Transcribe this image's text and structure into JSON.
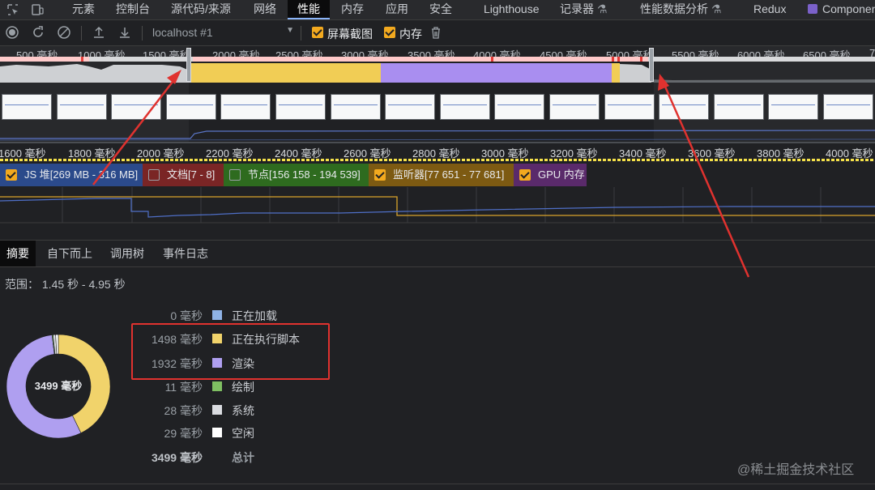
{
  "tabs": {
    "inspect_icon": "element-picker-icon",
    "device_icon": "device-toolbar-icon",
    "items": [
      {
        "label": "元素"
      },
      {
        "label": "控制台"
      },
      {
        "label": "源代码/来源"
      },
      {
        "label": "网络"
      },
      {
        "label": "性能"
      },
      {
        "label": "内存"
      },
      {
        "label": "应用"
      },
      {
        "label": "安全"
      },
      {
        "label": "Lighthouse"
      },
      {
        "label": "记录器"
      },
      {
        "label": "性能数据分析"
      },
      {
        "label": "Redux"
      },
      {
        "label": "Componen"
      }
    ],
    "active": "性能"
  },
  "toolbar": {
    "record_icon": "record-icon",
    "reload_icon": "reload-icon",
    "clear_icon": "clear-icon",
    "upload_icon": "upload-icon",
    "download_icon": "download-icon",
    "target": "localhost #1",
    "screenshots_label": "屏幕截图",
    "screenshots_checked": true,
    "memory_label": "内存",
    "memory_checked": true,
    "trash_icon": "trash-icon"
  },
  "overview": {
    "ticks": [
      "500 毫秒",
      "1000 毫秒",
      "1500 毫秒",
      "2000 毫秒",
      "2500 毫秒",
      "3000 毫秒",
      "3500 毫秒",
      "4000 毫秒",
      "4500 毫秒",
      "5000 毫秒",
      "5500 毫秒",
      "6000 毫秒",
      "6500 毫秒",
      "7"
    ],
    "selection_start_ms": 1450,
    "selection_end_ms": 4950
  },
  "timeline": {
    "ticks": [
      "1600 毫秒",
      "1800 毫秒",
      "2000 毫秒",
      "2200 毫秒",
      "2400 毫秒",
      "2600 毫秒",
      "2800 毫秒",
      "3000 毫秒",
      "3200 毫秒",
      "3400 毫秒",
      "3600 毫秒",
      "3800 毫秒",
      "4000 毫秒"
    ]
  },
  "counters": [
    {
      "label": "JS 堆[269 MB - 316 MB]",
      "checked": true,
      "color": "#2b4a8b"
    },
    {
      "label": "文档[7 - 8]",
      "checked": false,
      "color": "#7a2525"
    },
    {
      "label": "节点[156 158 - 194 539]",
      "checked": false,
      "color": "#2e6b1f"
    },
    {
      "label": "监听器[77 651 - 77 681]",
      "checked": true,
      "color": "#7d5a12"
    },
    {
      "label": "GPU 内存",
      "checked": true,
      "color": "#5a2a6b"
    }
  ],
  "summary": {
    "tabs": [
      "摘要",
      "自下而上",
      "调用树",
      "事件日志"
    ],
    "range": "范围： 1.45 秒 - 4.95 秒",
    "total_center": "3499 毫秒",
    "rows": [
      {
        "value": "0 毫秒",
        "label": "正在加载",
        "color": "#8fb3e6",
        "ms": 0
      },
      {
        "value": "1498 毫秒",
        "label": "正在执行脚本",
        "color": "#f1d36b",
        "ms": 1498
      },
      {
        "value": "1932 毫秒",
        "label": "渲染",
        "color": "#af9ff0",
        "ms": 1932
      },
      {
        "value": "11 毫秒",
        "label": "绘制",
        "color": "#7fbf62",
        "ms": 11
      },
      {
        "value": "28 毫秒",
        "label": "系统",
        "color": "#dadce0",
        "ms": 28
      },
      {
        "value": "29 毫秒",
        "label": "空闲",
        "color": "#ffffff",
        "ms": 29
      }
    ],
    "total_value": "3499 毫秒",
    "total_label": "总计"
  },
  "watermark": "@稀土掘金技术社区"
}
